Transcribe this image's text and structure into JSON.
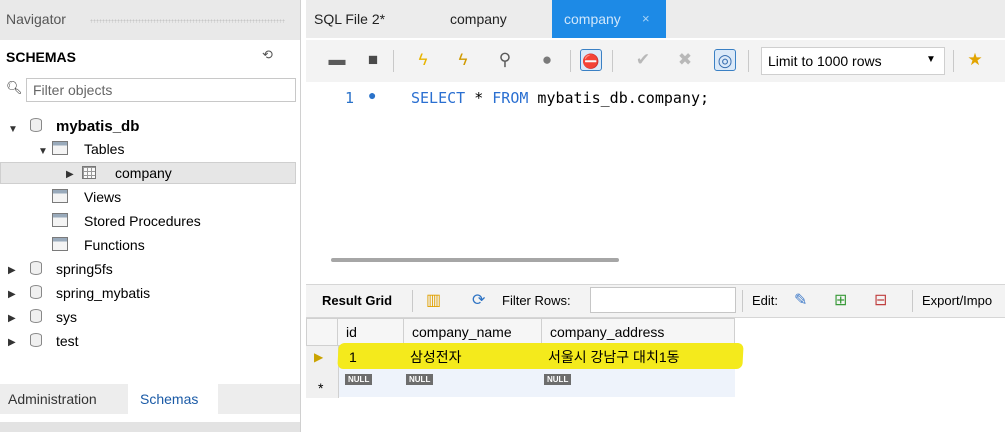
{
  "navigator": {
    "title": "Navigator",
    "schemas_label": "SCHEMAS",
    "filter_placeholder": "Filter objects",
    "tree": {
      "db": "mybatis_db",
      "tables": "Tables",
      "table": "company",
      "views": "Views",
      "stored_procedures": "Stored Procedures",
      "functions": "Functions",
      "other_dbs": [
        "spring5fs",
        "spring_mybatis",
        "sys",
        "test"
      ]
    },
    "bottom_tabs": {
      "admin": "Administration",
      "schemas": "Schemas"
    }
  },
  "tabs": {
    "sql_file": "SQL File 2*",
    "company_1": "company",
    "company_2": "company",
    "close": "×"
  },
  "toolbar": {
    "limit": "Limit to 1000 rows"
  },
  "editor": {
    "line_number": "1",
    "line_marker": "●",
    "kw_select": "SELECT",
    "star": " * ",
    "kw_from": "FROM",
    "rest": " mybatis_db.company;"
  },
  "results": {
    "result_grid": "Result Grid",
    "filter_rows": "Filter Rows:",
    "edit": "Edit:",
    "export": "Export/Impo",
    "columns": [
      "id",
      "company_name",
      "company_address"
    ],
    "row": [
      "1",
      "삼성전자",
      "서울시 강남구 대치1동"
    ],
    "null": "NULL",
    "new_row_marker": "*",
    "highlight_color": "#f4ea1c"
  }
}
